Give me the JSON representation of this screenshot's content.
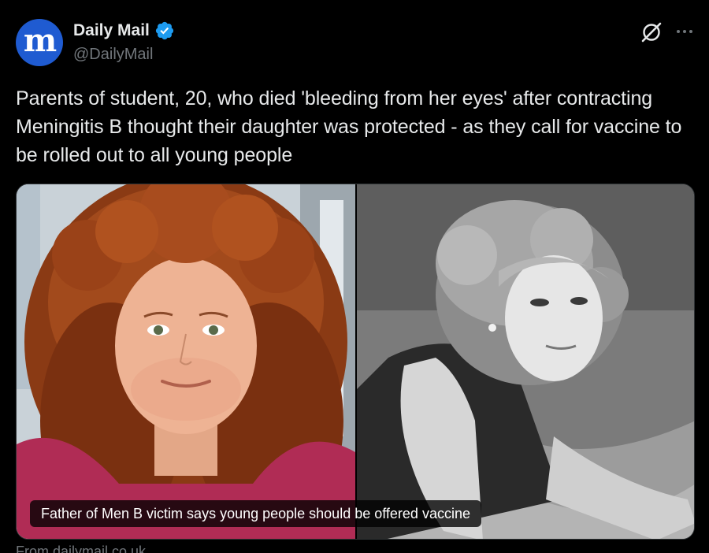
{
  "author": {
    "display_name": "Daily Mail",
    "handle": "@DailyMail",
    "avatar_glyph": "m",
    "avatar_color": "#1f5bd1",
    "verified_color": "#1d9bf0"
  },
  "actions": {
    "grok_icon": "grok-icon",
    "more_icon": "more-options-icon"
  },
  "tweet": {
    "text": "Parents of student, 20, who died 'bleeding from her eyes' after contracting Meningitis B thought their daughter was protected - as they call for vaccine to be rolled out to all young people"
  },
  "card": {
    "caption": "Father of Men B victim says young people should be offered vaccine",
    "source": "From dailymail.co.uk"
  },
  "colors": {
    "background": "#000000",
    "text_primary": "#e7e9ea",
    "text_secondary": "#71767b",
    "border": "#2f3336"
  }
}
